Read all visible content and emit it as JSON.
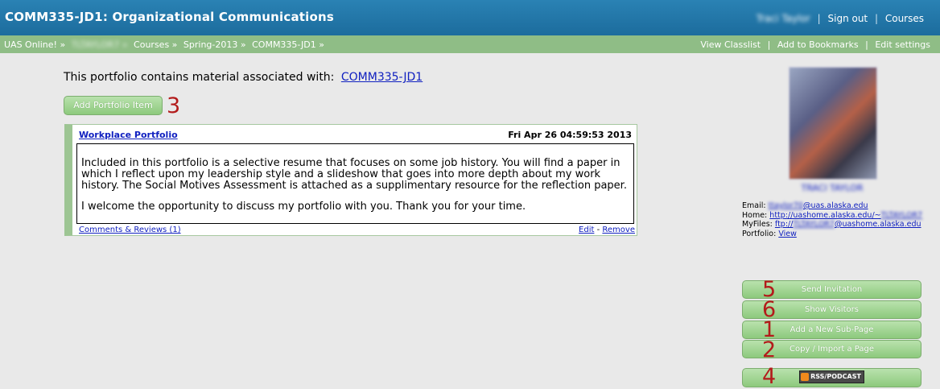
{
  "header": {
    "title": "COMM335-JD1: Organizational Communications",
    "user_name": "Traci Taylor",
    "sign_out": "Sign out",
    "courses": "Courses"
  },
  "breadcrumb": {
    "items": [
      "UAS Online! »",
      "TLTAYLOR7 »",
      "Courses »",
      "Spring-2013 »",
      "COMM335-JD1 »"
    ],
    "actions": [
      "View Classlist",
      "Add to Bookmarks",
      "Edit settings"
    ]
  },
  "main": {
    "association_text": "This portfolio contains material associated with:",
    "association_link": "COMM335-JD1",
    "add_item_label": "Add Portfolio Item",
    "portfolio": {
      "title": "Workplace Portfolio",
      "date": "Fri Apr 26 04:59:53 2013",
      "paragraph1": "Included in this portfolio is a selective resume that focuses on some job history.  You will find a paper in which I reflect upon my leadership style and a slideshow that goes into more depth about my work history.  The Social Motives Assessment is attached as a supplimentary resource for the reflection paper.",
      "paragraph2": "I welcome the opportunity to discuss my portfolio with you.  Thank you for your time.",
      "comments_link": "Comments & Reviews (1)",
      "edit_link": "Edit",
      "separator": "-",
      "remove_link": "Remove"
    }
  },
  "sidebar": {
    "profile_name": "TRACI TAYLOR",
    "email_label": "Email:",
    "email_user": "ttaylor70",
    "email_domain": "@uas.alaska.edu",
    "home_label": "Home:",
    "home_url": "http://uashome.alaska.edu/~",
    "home_user": "TLTAYLOR7",
    "myfiles_label": "MyFiles:",
    "myfiles_prefix": "ftp://",
    "myfiles_user": "TLTAYLOR7",
    "myfiles_suffix": "@uashome.alaska.edu",
    "portfolio_label": "Portfolio:",
    "portfolio_link": "View",
    "buttons": {
      "send_invitation": "Send Invitation",
      "show_visitors": "Show Visitors",
      "add_subpage": "Add a New Sub-Page",
      "copy_import": "Copy / Import a Page",
      "rss_podcast": "RSS/PODCAST"
    }
  },
  "annotations": {
    "n3": "3",
    "n5": "5",
    "n6": "6",
    "n1": "1",
    "n2": "2",
    "n4": "4",
    "color": "#b31b1b"
  }
}
